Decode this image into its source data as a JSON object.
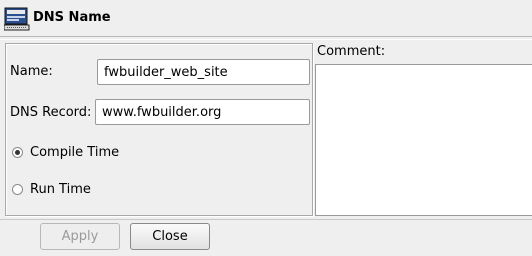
{
  "header": {
    "title": "DNS Name",
    "icon": "dns-name-icon"
  },
  "form": {
    "name_label": "Name:",
    "name_value": "fwbuilder_web_site",
    "dns_record_label": "DNS Record:",
    "dns_record_value": "www.fwbuilder.org",
    "radio_compile_label": "Compile Time",
    "radio_compile_checked": true,
    "radio_run_label": "Run Time",
    "radio_run_checked": false
  },
  "comment": {
    "label": "Comment:",
    "value": ""
  },
  "buttons": {
    "apply": "Apply",
    "close": "Close"
  }
}
